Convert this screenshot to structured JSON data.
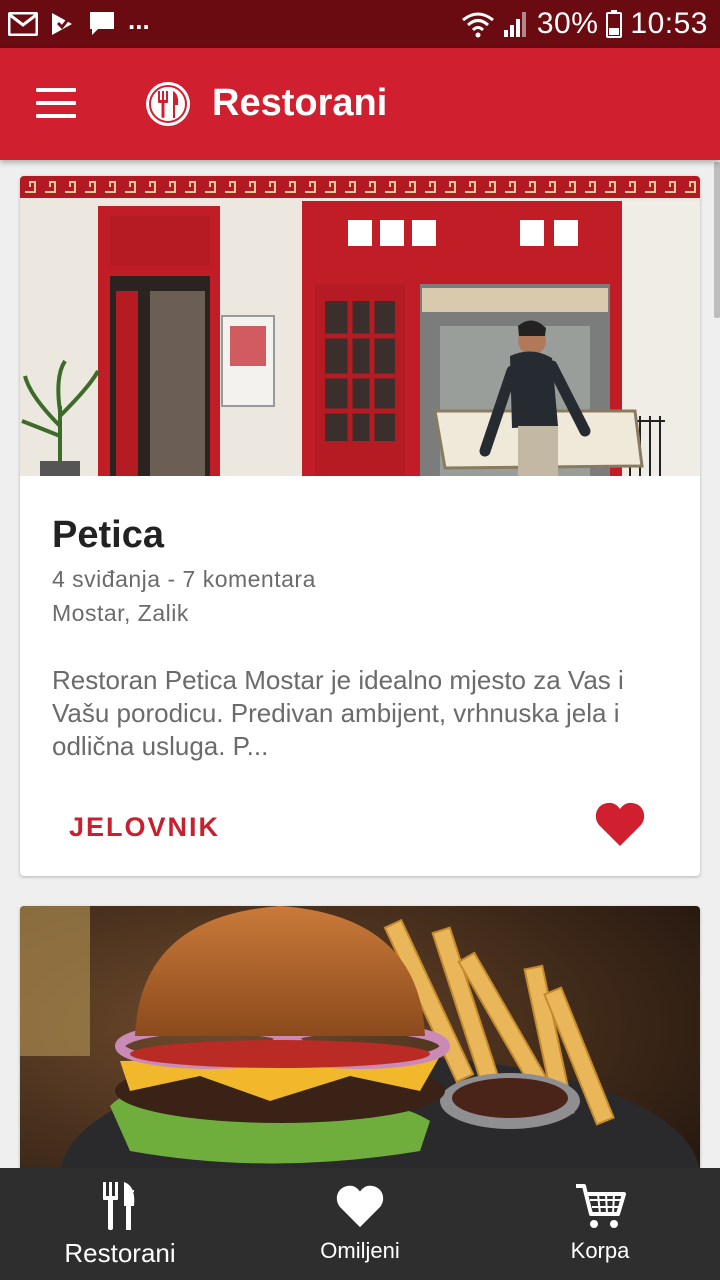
{
  "status_bar": {
    "battery": "30%",
    "time": "10:53",
    "more": "..."
  },
  "app_bar": {
    "title": "Restorani"
  },
  "restaurants": [
    {
      "name": "Petica",
      "stats": "4 sviđanja - 7 komentara",
      "location": "Mostar, Zalik",
      "description": "Restoran Petica Mostar je idealno mjesto za Vas i Vašu porodicu. Predivan ambijent, vrhnuska jela i odlična usluga. P...",
      "menu_label": "JELOVNIK",
      "favorited": true
    }
  ],
  "bottom_nav": [
    {
      "label": "Restorani",
      "icon": "cutlery-icon",
      "active": true
    },
    {
      "label": "Omiljeni",
      "icon": "heart-icon",
      "active": false
    },
    {
      "label": "Korpa",
      "icon": "cart-icon",
      "active": false
    }
  ],
  "colors": {
    "primary": "#d0202f",
    "status_bar": "#6a0b12",
    "bottom_nav": "#2e2e2e"
  }
}
